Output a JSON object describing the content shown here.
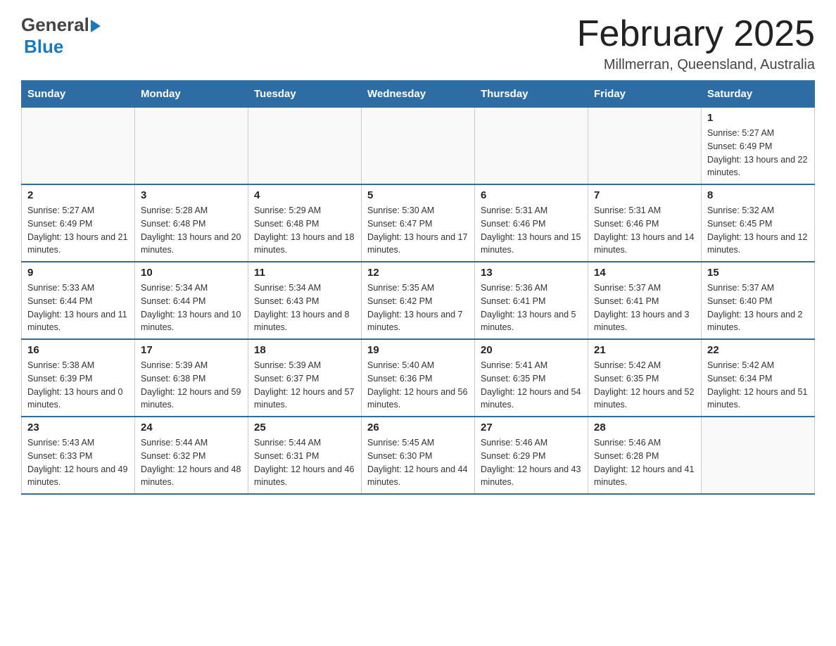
{
  "logo": {
    "general": "General",
    "blue": "Blue"
  },
  "title": "February 2025",
  "subtitle": "Millmerran, Queensland, Australia",
  "days_of_week": [
    "Sunday",
    "Monday",
    "Tuesday",
    "Wednesday",
    "Thursday",
    "Friday",
    "Saturday"
  ],
  "weeks": [
    {
      "days": [
        {
          "date": "",
          "info": ""
        },
        {
          "date": "",
          "info": ""
        },
        {
          "date": "",
          "info": ""
        },
        {
          "date": "",
          "info": ""
        },
        {
          "date": "",
          "info": ""
        },
        {
          "date": "",
          "info": ""
        },
        {
          "date": "1",
          "sunrise": "Sunrise: 5:27 AM",
          "sunset": "Sunset: 6:49 PM",
          "daylight": "Daylight: 13 hours and 22 minutes."
        }
      ]
    },
    {
      "days": [
        {
          "date": "2",
          "sunrise": "Sunrise: 5:27 AM",
          "sunset": "Sunset: 6:49 PM",
          "daylight": "Daylight: 13 hours and 21 minutes."
        },
        {
          "date": "3",
          "sunrise": "Sunrise: 5:28 AM",
          "sunset": "Sunset: 6:48 PM",
          "daylight": "Daylight: 13 hours and 20 minutes."
        },
        {
          "date": "4",
          "sunrise": "Sunrise: 5:29 AM",
          "sunset": "Sunset: 6:48 PM",
          "daylight": "Daylight: 13 hours and 18 minutes."
        },
        {
          "date": "5",
          "sunrise": "Sunrise: 5:30 AM",
          "sunset": "Sunset: 6:47 PM",
          "daylight": "Daylight: 13 hours and 17 minutes."
        },
        {
          "date": "6",
          "sunrise": "Sunrise: 5:31 AM",
          "sunset": "Sunset: 6:46 PM",
          "daylight": "Daylight: 13 hours and 15 minutes."
        },
        {
          "date": "7",
          "sunrise": "Sunrise: 5:31 AM",
          "sunset": "Sunset: 6:46 PM",
          "daylight": "Daylight: 13 hours and 14 minutes."
        },
        {
          "date": "8",
          "sunrise": "Sunrise: 5:32 AM",
          "sunset": "Sunset: 6:45 PM",
          "daylight": "Daylight: 13 hours and 12 minutes."
        }
      ]
    },
    {
      "days": [
        {
          "date": "9",
          "sunrise": "Sunrise: 5:33 AM",
          "sunset": "Sunset: 6:44 PM",
          "daylight": "Daylight: 13 hours and 11 minutes."
        },
        {
          "date": "10",
          "sunrise": "Sunrise: 5:34 AM",
          "sunset": "Sunset: 6:44 PM",
          "daylight": "Daylight: 13 hours and 10 minutes."
        },
        {
          "date": "11",
          "sunrise": "Sunrise: 5:34 AM",
          "sunset": "Sunset: 6:43 PM",
          "daylight": "Daylight: 13 hours and 8 minutes."
        },
        {
          "date": "12",
          "sunrise": "Sunrise: 5:35 AM",
          "sunset": "Sunset: 6:42 PM",
          "daylight": "Daylight: 13 hours and 7 minutes."
        },
        {
          "date": "13",
          "sunrise": "Sunrise: 5:36 AM",
          "sunset": "Sunset: 6:41 PM",
          "daylight": "Daylight: 13 hours and 5 minutes."
        },
        {
          "date": "14",
          "sunrise": "Sunrise: 5:37 AM",
          "sunset": "Sunset: 6:41 PM",
          "daylight": "Daylight: 13 hours and 3 minutes."
        },
        {
          "date": "15",
          "sunrise": "Sunrise: 5:37 AM",
          "sunset": "Sunset: 6:40 PM",
          "daylight": "Daylight: 13 hours and 2 minutes."
        }
      ]
    },
    {
      "days": [
        {
          "date": "16",
          "sunrise": "Sunrise: 5:38 AM",
          "sunset": "Sunset: 6:39 PM",
          "daylight": "Daylight: 13 hours and 0 minutes."
        },
        {
          "date": "17",
          "sunrise": "Sunrise: 5:39 AM",
          "sunset": "Sunset: 6:38 PM",
          "daylight": "Daylight: 12 hours and 59 minutes."
        },
        {
          "date": "18",
          "sunrise": "Sunrise: 5:39 AM",
          "sunset": "Sunset: 6:37 PM",
          "daylight": "Daylight: 12 hours and 57 minutes."
        },
        {
          "date": "19",
          "sunrise": "Sunrise: 5:40 AM",
          "sunset": "Sunset: 6:36 PM",
          "daylight": "Daylight: 12 hours and 56 minutes."
        },
        {
          "date": "20",
          "sunrise": "Sunrise: 5:41 AM",
          "sunset": "Sunset: 6:35 PM",
          "daylight": "Daylight: 12 hours and 54 minutes."
        },
        {
          "date": "21",
          "sunrise": "Sunrise: 5:42 AM",
          "sunset": "Sunset: 6:35 PM",
          "daylight": "Daylight: 12 hours and 52 minutes."
        },
        {
          "date": "22",
          "sunrise": "Sunrise: 5:42 AM",
          "sunset": "Sunset: 6:34 PM",
          "daylight": "Daylight: 12 hours and 51 minutes."
        }
      ]
    },
    {
      "days": [
        {
          "date": "23",
          "sunrise": "Sunrise: 5:43 AM",
          "sunset": "Sunset: 6:33 PM",
          "daylight": "Daylight: 12 hours and 49 minutes."
        },
        {
          "date": "24",
          "sunrise": "Sunrise: 5:44 AM",
          "sunset": "Sunset: 6:32 PM",
          "daylight": "Daylight: 12 hours and 48 minutes."
        },
        {
          "date": "25",
          "sunrise": "Sunrise: 5:44 AM",
          "sunset": "Sunset: 6:31 PM",
          "daylight": "Daylight: 12 hours and 46 minutes."
        },
        {
          "date": "26",
          "sunrise": "Sunrise: 5:45 AM",
          "sunset": "Sunset: 6:30 PM",
          "daylight": "Daylight: 12 hours and 44 minutes."
        },
        {
          "date": "27",
          "sunrise": "Sunrise: 5:46 AM",
          "sunset": "Sunset: 6:29 PM",
          "daylight": "Daylight: 12 hours and 43 minutes."
        },
        {
          "date": "28",
          "sunrise": "Sunrise: 5:46 AM",
          "sunset": "Sunset: 6:28 PM",
          "daylight": "Daylight: 12 hours and 41 minutes."
        },
        {
          "date": "",
          "info": ""
        }
      ]
    }
  ]
}
